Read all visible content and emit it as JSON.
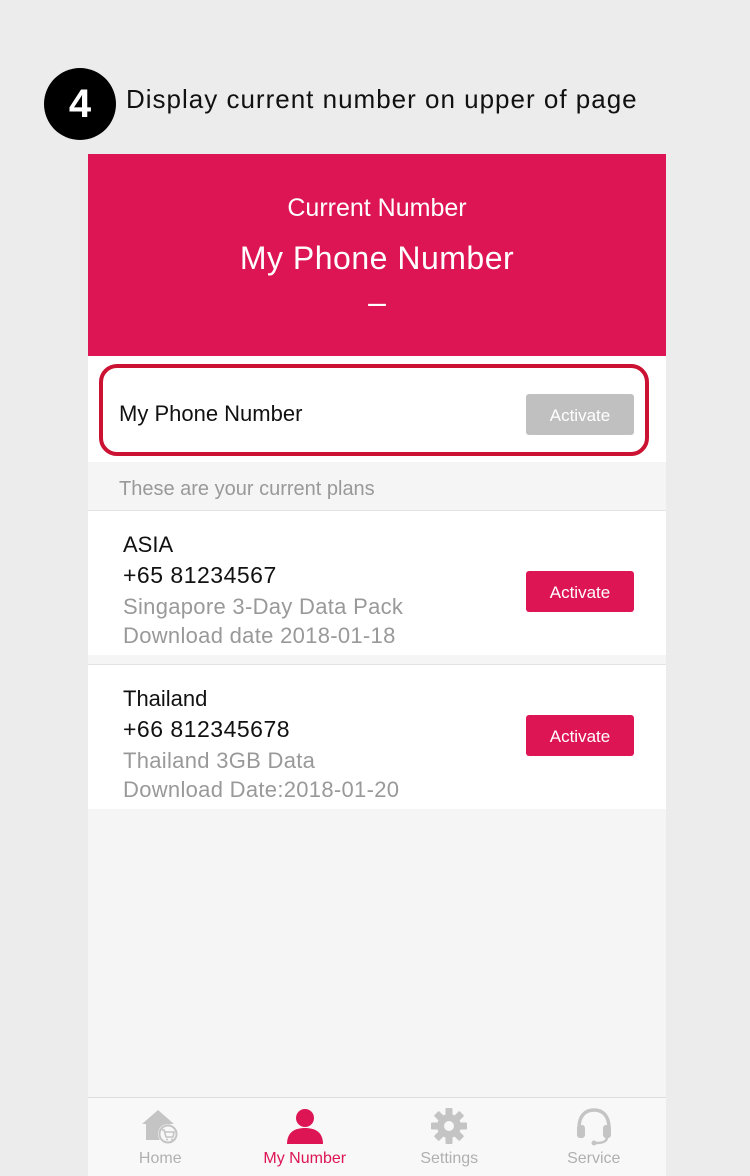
{
  "step": {
    "number": "4",
    "caption": "Display current number  on upper of page"
  },
  "header": {
    "subtitle": "Current Number",
    "title": "My Phone Number",
    "number": "–"
  },
  "current_card": {
    "label": "My Phone Number",
    "button_label": "Activate"
  },
  "plans_caption": "These are your current plans",
  "plans": [
    {
      "region": "ASIA",
      "phone": "+65 81234567",
      "pack": "Singapore 3-Day Data Pack",
      "date": "Download date 2018-01-18",
      "button_label": "Activate"
    },
    {
      "region": "Thailand",
      "phone": "+66 812345678",
      "pack": "Thailand 3GB Data",
      "date": "Download Date:2018-01-20",
      "button_label": "Activate"
    }
  ],
  "tabs": [
    {
      "label": "Home",
      "icon": "home-cart-icon",
      "active": false
    },
    {
      "label": "My Number",
      "icon": "user-icon",
      "active": true
    },
    {
      "label": "Settings",
      "icon": "gear-icon",
      "active": false
    },
    {
      "label": "Service",
      "icon": "headset-icon",
      "active": false
    }
  ],
  "colors": {
    "brand": "#dd1555",
    "highlight": "#cc1232",
    "disabled_button": "#c0c0c0"
  }
}
